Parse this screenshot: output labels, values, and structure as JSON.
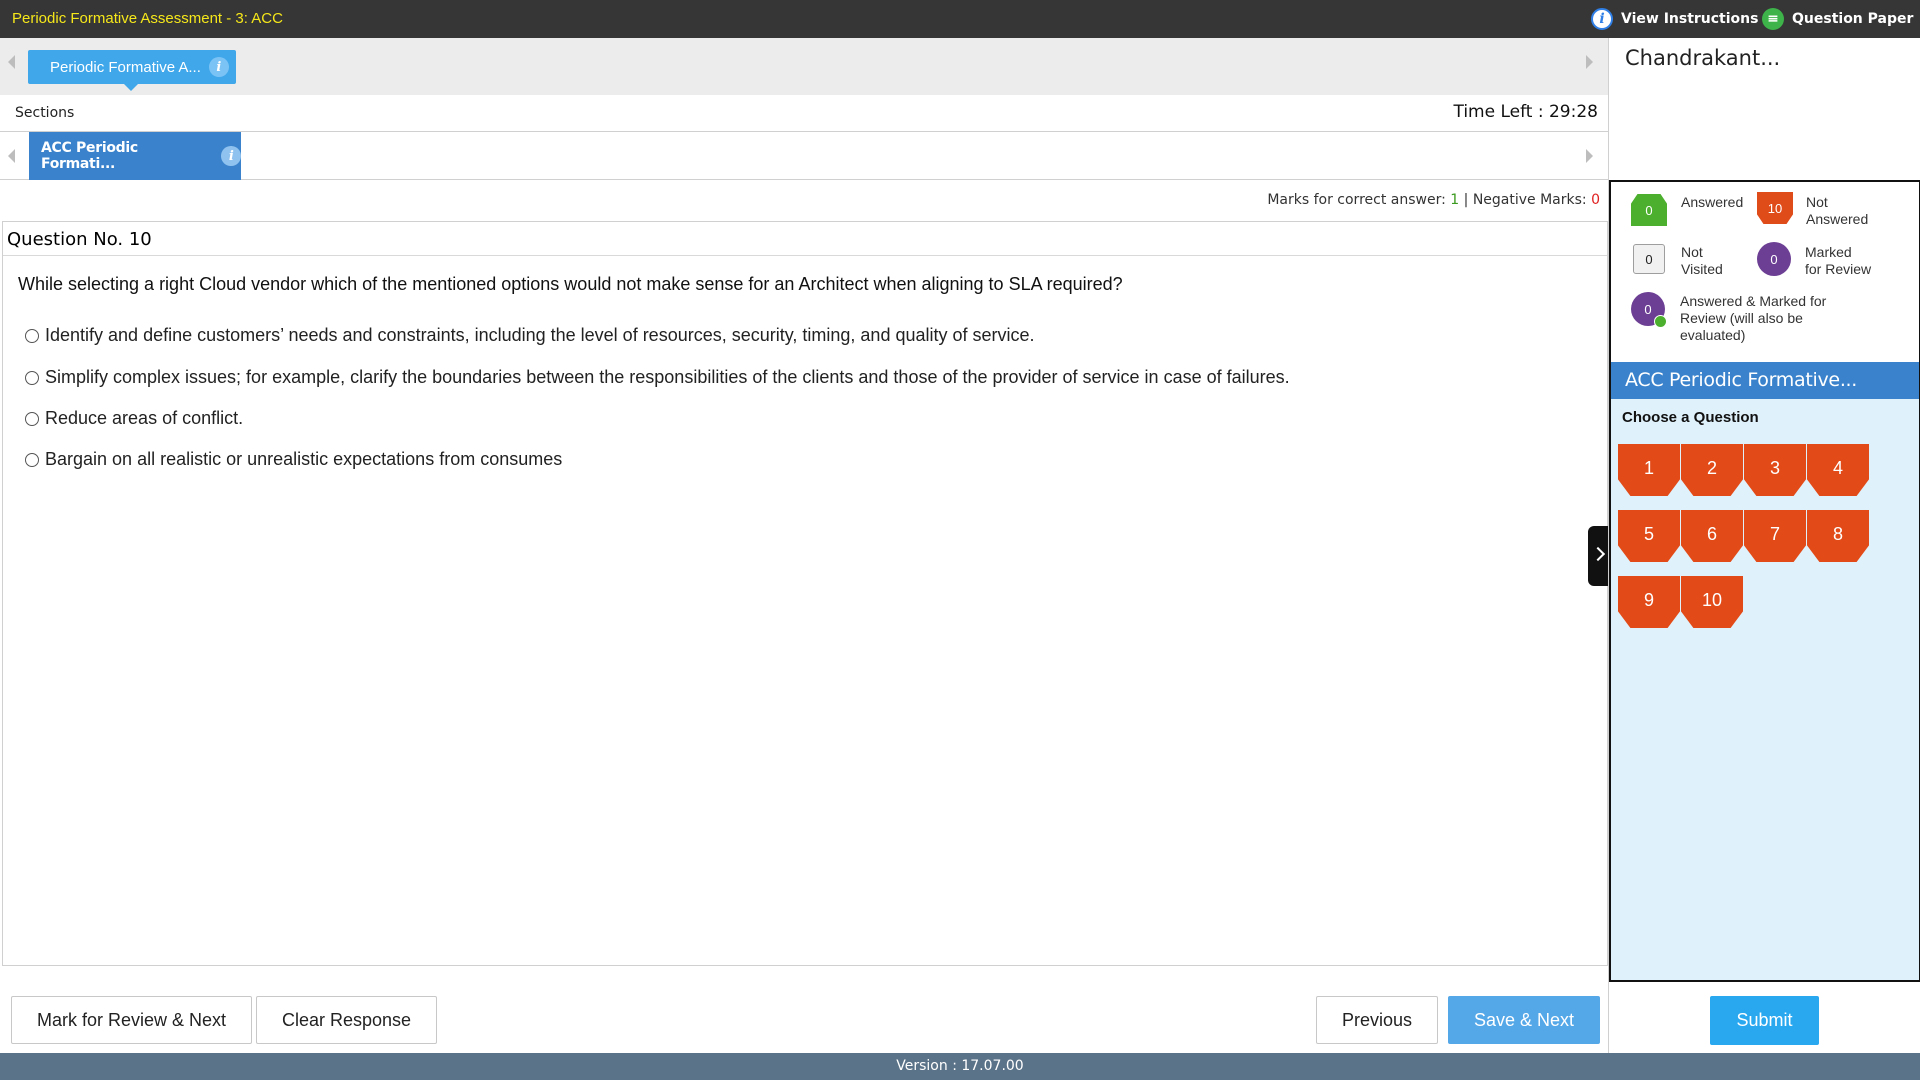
{
  "header": {
    "title": "Periodic Formative Assessment - 3: ACC",
    "view_instructions": "View Instructions",
    "question_paper": "Question Paper"
  },
  "assessment_tab": {
    "label": "Periodic Formative A..."
  },
  "sections": {
    "label": "Sections",
    "time_left": "Time Left : 29:28"
  },
  "section_tab": {
    "label": "ACC Periodic Formati..."
  },
  "marks": {
    "correct_label": "Marks for correct answer:",
    "correct_value": "1",
    "separator": "|",
    "negative_label": "Negative Marks:",
    "negative_value": "0"
  },
  "question": {
    "number_label": "Question No. 10",
    "text": "While selecting a right Cloud vendor which of the mentioned options would not make sense for an Architect when aligning to SLA required?",
    "options": [
      "Identify and define customers’ needs and constraints, including the level of resources, security, timing, and quality of service.",
      "Simplify complex issues; for example, clarify the boundaries between the responsibilities of the clients and those of the provider of service in case of failures.",
      "Reduce areas of conflict.",
      "Bargain on all realistic or unrealistic expectations from consumes"
    ]
  },
  "actions": {
    "mark_review": "Mark for Review & Next",
    "clear": "Clear Response",
    "previous": "Previous",
    "save_next": "Save & Next",
    "submit": "Submit"
  },
  "footer": {
    "version": "Version : 17.07.00"
  },
  "user": {
    "name": "Chandrakant..."
  },
  "legend": {
    "answered": {
      "count": "0",
      "label": "Answered"
    },
    "not_answered": {
      "count": "10",
      "label1": "Not",
      "label2": "Answered"
    },
    "not_visited": {
      "count": "0",
      "label1": "Not",
      "label2": "Visited"
    },
    "marked": {
      "count": "0",
      "label1": "Marked",
      "label2": "for Review"
    },
    "answered_marked": {
      "count": "0",
      "label1": "Answered & Marked for",
      "label2": "Review (will also be",
      "label3": "evaluated)"
    }
  },
  "palette": {
    "section_title": "ACC Periodic Formative...",
    "choose_label": "Choose a Question",
    "questions": [
      "1",
      "2",
      "3",
      "4",
      "5",
      "6",
      "7",
      "8",
      "9",
      "10"
    ]
  },
  "colors": {
    "accent": "#3a83cc",
    "not_answered": "#e24a17",
    "answered": "#4caf2e",
    "marked": "#6c3f94",
    "timer_bar": "#363636"
  }
}
